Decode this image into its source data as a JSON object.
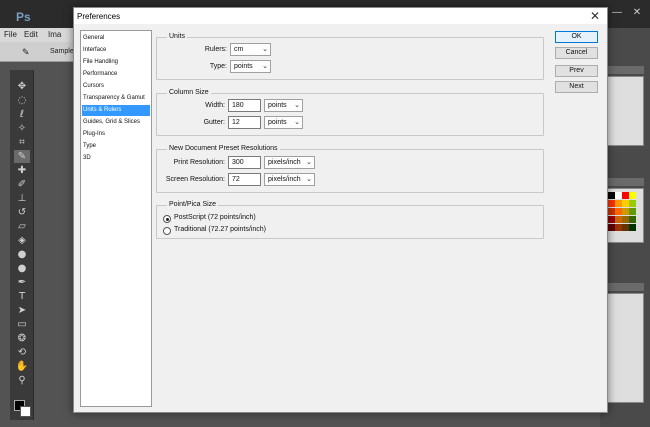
{
  "background_app": {
    "logo": "Ps",
    "menu": [
      "File",
      "Edit",
      "Ima"
    ],
    "options_bar_text": "Sample"
  },
  "dialog": {
    "title": "Preferences",
    "nav": [
      "General",
      "Interface",
      "File Handling",
      "Performance",
      "Cursors",
      "Transparency & Gamut",
      "Units & Rulers",
      "Guides, Grid & Slices",
      "Plug-Ins",
      "Type",
      "3D"
    ],
    "selected_nav": "Units & Rulers",
    "units": {
      "title": "Units",
      "rulers_label": "Rulers:",
      "rulers_value": "cm",
      "type_label": "Type:",
      "type_value": "points"
    },
    "column_size": {
      "title": "Column Size",
      "width_label": "Width:",
      "width_value": "180",
      "width_unit": "points",
      "gutter_label": "Gutter:",
      "gutter_value": "12",
      "gutter_unit": "points"
    },
    "preset_resolutions": {
      "title": "New Document Preset Resolutions",
      "print_label": "Print Resolution:",
      "print_value": "300",
      "print_unit": "pixels/inch",
      "screen_label": "Screen Resolution:",
      "screen_value": "72",
      "screen_unit": "pixels/inch"
    },
    "point_pica": {
      "title": "Point/Pica Size",
      "options": [
        "PostScript (72 points/inch)",
        "Traditional (72.27 points/inch)"
      ],
      "selected": "PostScript (72 points/inch)"
    },
    "buttons": {
      "ok": "OK",
      "cancel": "Cancel",
      "prev": "Prev",
      "next": "Next"
    }
  },
  "colors": {
    "selection": "#3399ff",
    "dialog_bg": "#f0f0f0",
    "ps_dark": "#535353"
  }
}
